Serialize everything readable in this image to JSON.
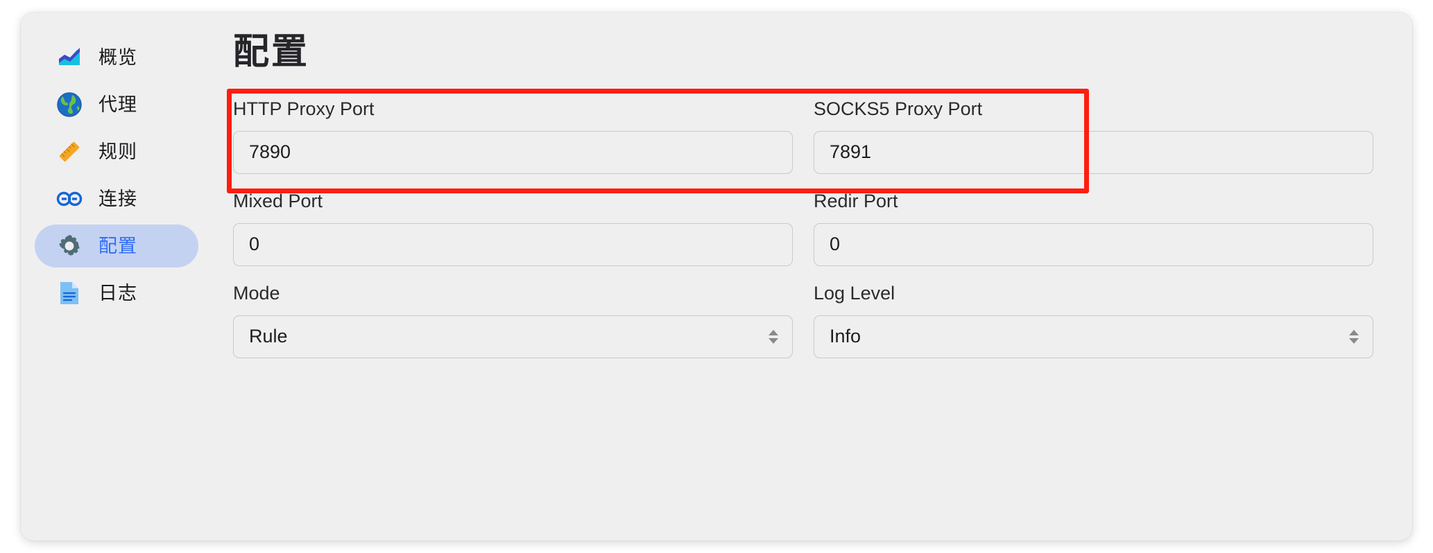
{
  "app": {
    "accent_color": "#2f6df6",
    "active_pill_color": "#c4d2f2",
    "background_color": "#efeff0",
    "highlight_color": "#ff1d0f"
  },
  "sidebar": {
    "items": [
      {
        "id": "overview",
        "label": "概览",
        "icon": "chart-increasing-icon",
        "active": false
      },
      {
        "id": "proxies",
        "label": "代理",
        "icon": "globe-icon",
        "active": false
      },
      {
        "id": "rules",
        "label": "规则",
        "icon": "ruler-icon",
        "active": false
      },
      {
        "id": "connections",
        "label": "连接",
        "icon": "link-icon",
        "active": false
      },
      {
        "id": "config",
        "label": "配置",
        "icon": "gear-icon",
        "active": true
      },
      {
        "id": "logs",
        "label": "日志",
        "icon": "document-icon",
        "active": false
      }
    ]
  },
  "main": {
    "title": "配置",
    "fields": [
      {
        "id": "http-proxy-port",
        "label": "HTTP Proxy Port",
        "value": "7890",
        "type": "text"
      },
      {
        "id": "socks5-proxy-port",
        "label": "SOCKS5 Proxy Port",
        "value": "7891",
        "type": "text"
      },
      {
        "id": "mixed-port",
        "label": "Mixed Port",
        "value": "0",
        "type": "text"
      },
      {
        "id": "redir-port",
        "label": "Redir Port",
        "value": "0",
        "type": "text"
      },
      {
        "id": "mode",
        "label": "Mode",
        "value": "Rule",
        "type": "select"
      },
      {
        "id": "log-level",
        "label": "Log Level",
        "value": "Info",
        "type": "select"
      }
    ]
  },
  "annotation": {
    "highlight_label": "red-box-around-http-and-socks5-proxy-port-fields"
  }
}
